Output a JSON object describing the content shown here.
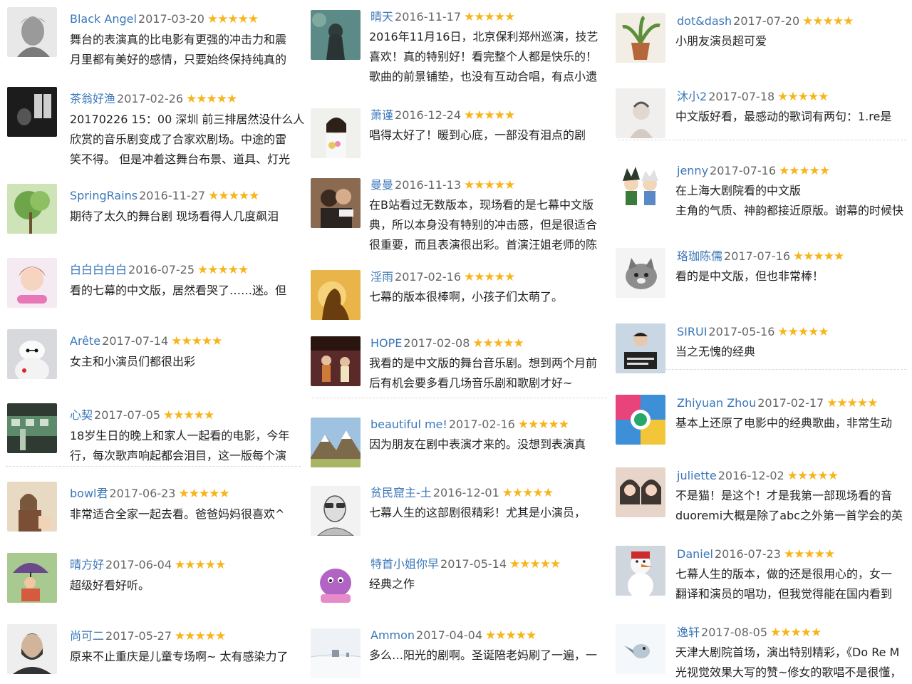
{
  "colors": {
    "username": "#3b77b8",
    "star": "#f7b51c",
    "date": "#666666",
    "text": "#222222"
  },
  "stars_glyph": "★★★★★",
  "columns": [
    {
      "reviews": [
        {
          "user": "Black Angel",
          "date": "2017-03-20",
          "rating": 5,
          "avatar": "avatar-bw-portrait",
          "lines": [
            "舞台的表演真的比电影有更强的冲击力和震",
            "月里都有美好的感情，只要始终保持纯真的"
          ]
        },
        {
          "user": "茶翁好渔",
          "date": "2017-02-26",
          "rating": 5,
          "avatar": "avatar-dark-window",
          "lines": [
            "20170226 15：00 深圳 前三排居然没什么人",
            "欣赏的音乐剧变成了合家欢剧场。中途的雷",
            "笑不得。 但是冲着这舞台布景、道具、灯光"
          ]
        },
        {
          "user": "SpringRains",
          "date": "2016-11-27",
          "rating": 5,
          "avatar": "avatar-green-tree",
          "lines": [
            "期待了太久的舞台剧 现场看得人几度飙泪"
          ]
        },
        {
          "user": "白白白白白",
          "date": "2016-07-25",
          "rating": 5,
          "avatar": "avatar-cartoon-girl",
          "lines": [
            "看的七幕的中文版，居然看哭了……迷。但"
          ]
        },
        {
          "user": "Arête",
          "date": "2017-07-14",
          "rating": 5,
          "avatar": "avatar-white-robot",
          "lines": [
            "女主和小演员们都很出彩"
          ]
        },
        {
          "user": "心契",
          "date": "2017-07-05",
          "rating": 5,
          "avatar": "avatar-green-train",
          "lines": [
            "18岁生日的晚上和家人一起看的电影，今年",
            "行，每次歌声响起都会泪目，这一版每个演"
          ]
        },
        {
          "user": "bowl君",
          "date": "2017-06-23",
          "rating": 5,
          "avatar": "avatar-woman-photo",
          "lines": [
            "非常适合全家一起去看。爸爸妈妈很喜欢^"
          ]
        },
        {
          "user": "晴方好",
          "date": "2017-06-04",
          "rating": 5,
          "avatar": "avatar-umbrella-cartoon",
          "lines": [
            "超级好看好听。"
          ]
        },
        {
          "user": "尚可二",
          "date": "2017-05-27",
          "rating": 5,
          "avatar": "avatar-bearded-man",
          "lines": [
            "原来不止重庆是儿童专场啊~ 太有感染力了"
          ]
        }
      ]
    },
    {
      "reviews": [
        {
          "user": "晴天",
          "date": "2016-11-17",
          "rating": 5,
          "avatar": "avatar-girl-forest",
          "lines": [
            "2016年11月16日，北京保利郑州巡演，技艺",
            "喜欢！真的特别好！看完整个人都是快乐的！",
            "歌曲的前景铺垫，也没有互动合唱，有点小遗"
          ]
        },
        {
          "user": "萧谨",
          "date": "2016-12-24",
          "rating": 5,
          "avatar": "avatar-girl-flowers",
          "lines": [
            "唱得太好了！暖到心底，一部没有泪点的剧"
          ]
        },
        {
          "user": "曼曼",
          "date": "2016-11-13",
          "rating": 5,
          "avatar": "avatar-couple-photo",
          "lines": [
            "在B站看过无数版本，现场看的是七幕中文版",
            "典，所以本身没有特别的冲击感，但是很适合",
            "很重要，而且表演很出彩。首演汪姐老师的陈"
          ]
        },
        {
          "user": "淫雨",
          "date": "2017-02-16",
          "rating": 5,
          "avatar": "avatar-golden-silhouette",
          "lines": [
            "七幕的版本很棒啊，小孩子们太萌了。"
          ]
        },
        {
          "user": "HOPE",
          "date": "2017-02-08",
          "rating": 5,
          "avatar": "avatar-stage-photo",
          "lines": [
            "我看的是中文版的舞台音乐剧。想到两个月前",
            "后有机会要多看几场音乐剧和歌剧才好~"
          ]
        },
        {
          "user": "beautiful me!",
          "date": "2017-02-16",
          "rating": 5,
          "avatar": "avatar-mountain",
          "lines": [
            "因为朋友在剧中表演才来的。没想到表演真"
          ]
        },
        {
          "user": "贫民窟主-土",
          "date": "2016-12-01",
          "rating": 5,
          "avatar": "avatar-sketch-man",
          "lines": [
            "七幕人生的这部剧很精彩！尤其是小演员，"
          ]
        },
        {
          "user": "特首小姐你早",
          "date": "2017-05-14",
          "rating": 5,
          "avatar": "avatar-purple-monster",
          "lines": [
            "经典之作"
          ]
        },
        {
          "user": "Ammon",
          "date": "2017-04-04",
          "rating": 5,
          "avatar": "avatar-snow-field",
          "lines": [
            "多么…阳光的剧啊。圣诞陪老妈刷了一遍，一"
          ]
        }
      ]
    },
    {
      "reviews": [
        {
          "user": "dot&dash",
          "date": "2017-07-20",
          "rating": 5,
          "avatar": "avatar-potted-plant",
          "lines": [
            "小朋友演员超可爱"
          ]
        },
        {
          "user": "沐小2",
          "date": "2017-07-18",
          "rating": 5,
          "avatar": "avatar-pale-figure",
          "lines": [
            "中文版好看，最感动的歌词有两句：1.re是"
          ]
        },
        {
          "user": "jenny",
          "date": "2017-07-16",
          "rating": 5,
          "avatar": "avatar-anime-boys",
          "lines": [
            "在上海大剧院看的中文版",
            "主角的气质、神韵都接近原版。谢幕的时候快"
          ]
        },
        {
          "user": "珞珈陈儒",
          "date": "2017-07-16",
          "rating": 5,
          "avatar": "avatar-cat",
          "lines": [
            "看的是中文版，但也非常棒！"
          ]
        },
        {
          "user": "SIRUI",
          "date": "2017-05-16",
          "rating": 5,
          "avatar": "avatar-man-sign",
          "lines": [
            "当之无愧的经典"
          ]
        },
        {
          "user": "Zhiyuan Zhou",
          "date": "2017-02-17",
          "rating": 5,
          "avatar": "avatar-colorful-collage",
          "lines": [
            "基本上还原了电影中的经典歌曲，非常生动"
          ]
        },
        {
          "user": "juliette",
          "date": "2016-12-02",
          "rating": 5,
          "avatar": "avatar-two-girls",
          "lines": [
            "不是猫！是这个！才是我第一部现场看的音",
            "duoremi大概是除了abc之外第一首学会的英"
          ]
        },
        {
          "user": "Daniel",
          "date": "2016-07-23",
          "rating": 5,
          "avatar": "avatar-snowman",
          "lines": [
            "七幕人生的版本，做的还是很用心的，女一",
            "翻译和演员的唱功，但我觉得能在国内看到"
          ]
        },
        {
          "user": "逸轩",
          "date": "2017-08-05",
          "rating": 5,
          "avatar": "avatar-bird-white",
          "lines": [
            "天津大剧院首场，演出特别精彩，《Do Re M",
            "光视觉效果大写的赞~修女的歌唱不是很懂，"
          ]
        }
      ]
    }
  ]
}
